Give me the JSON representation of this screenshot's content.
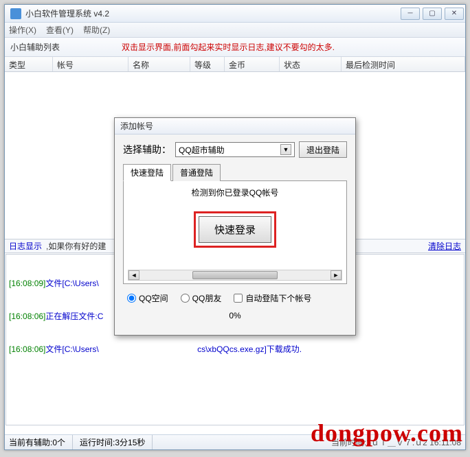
{
  "window": {
    "title": "小白软件管理系统   v4.2"
  },
  "menu": {
    "op": "操作(X)",
    "view": "查看(Y)",
    "help": "帮助(Z)"
  },
  "toolbar": {
    "label": "小白辅助列表",
    "tip": "双击显示界面,前面勾起来实时显示日志,建议不要勾的太多."
  },
  "columns": {
    "c1": "类型",
    "c2": "帐号",
    "c3": "名称",
    "c4": "等级",
    "c5": "金币",
    "c6": "状态",
    "c7": "最后检测时间"
  },
  "log": {
    "label": "日志显示",
    "tip": ",如果你有好的建",
    "clear": "清除日志",
    "lines": [
      {
        "time": "[16:08:09]",
        "text": "文件[C:\\Users\\                                              cs\\csset.dat]下载成功."
      },
      {
        "time": "[16:08:06]",
        "text": "正在解压文件:C                                             gZhiJia\\cs\\xbQQcs.exe.gz"
      },
      {
        "time": "[16:08:06]",
        "text": "文件[C:\\Users\\                                           cs\\xbQQcs.exe.gz]下载成功."
      }
    ]
  },
  "status": {
    "left": "当前有辅助:0个",
    "runtime": "运行时间:3分15秒",
    "right": "当前时间:2ｕｉ＿ｖ７.ｕ2 16:11:08"
  },
  "dialog": {
    "title": "添加帐号",
    "select_label": "选择辅助：",
    "select_value": "QQ超市辅助",
    "exit": "退出登陆",
    "tab1": "快速登陆",
    "tab2": "普通登陆",
    "detect": "检测到你已登录QQ帐号",
    "quick": "快速登录",
    "radio1": "QQ空间",
    "radio2": "QQ朋友",
    "check1": "自动登陆下个帐号",
    "percent": "0%"
  },
  "watermark": "dongpow.com"
}
